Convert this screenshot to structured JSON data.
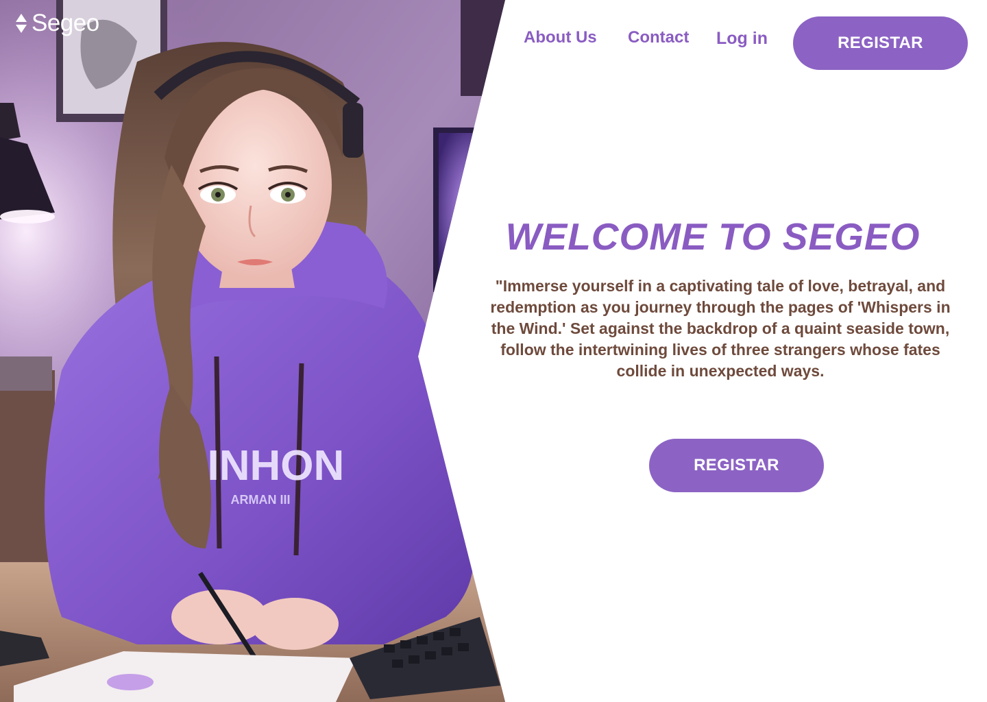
{
  "brand": {
    "name": "Segeo",
    "logo_icon": "sort-arrows-icon"
  },
  "nav": {
    "items": [
      {
        "label": "About Us"
      },
      {
        "label": "Contact"
      },
      {
        "label": "Log in"
      }
    ],
    "register_label": "REGISTAR"
  },
  "hero": {
    "title": "WELCOME TO SEGEO",
    "description": "\"Immerse yourself in a captivating tale of love, betrayal, and redemption as you journey through the pages of 'Whispers in the Wind.' Set against the backdrop of a quaint seaside town, follow the intertwining lives of three strangers whose fates collide in unexpected ways.",
    "register_label": "REGISTAR",
    "illustration_hoodie_text": "RINHON",
    "illustration_hoodie_subtext": "ARMAN III"
  },
  "colors": {
    "accent": "#8a5cc2",
    "button": "#8c63c4",
    "body_text": "#6e4a3c",
    "background": "#ffffff"
  }
}
